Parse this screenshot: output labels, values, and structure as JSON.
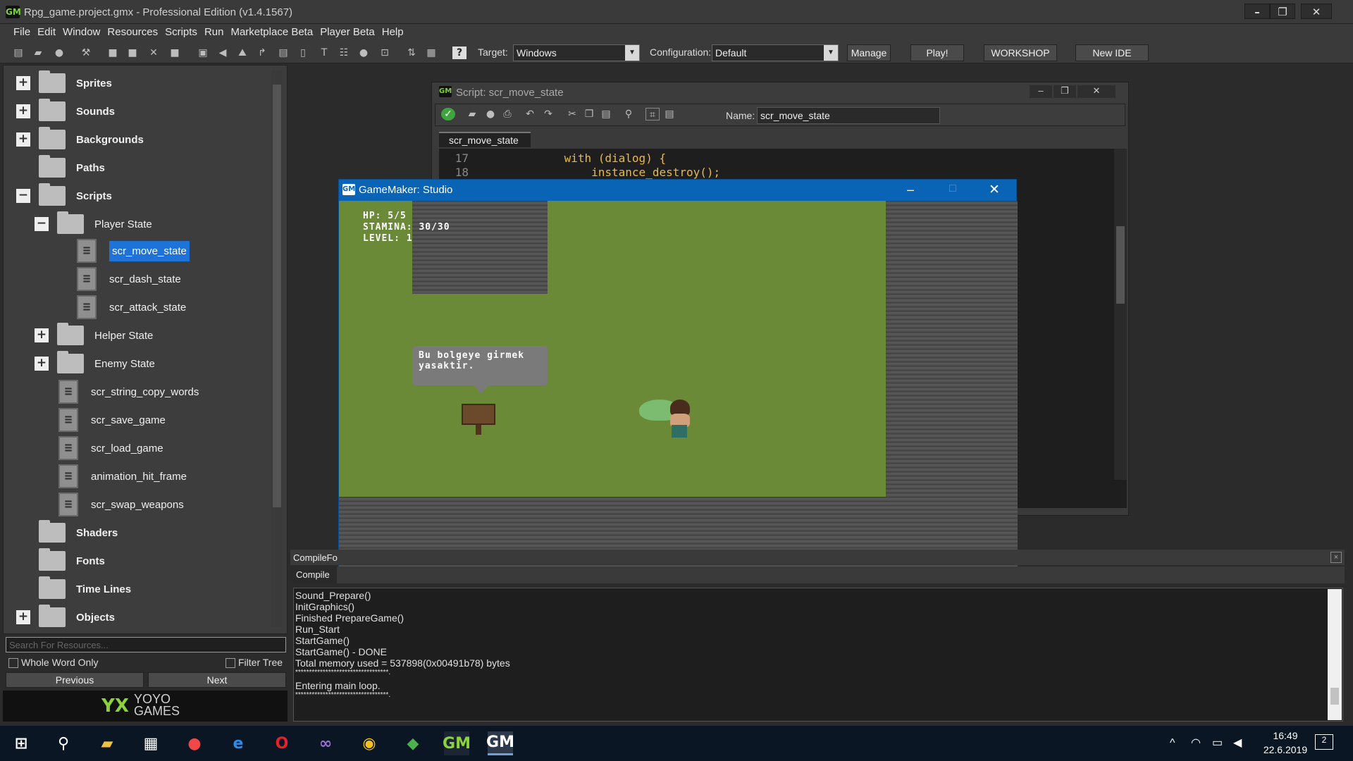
{
  "window": {
    "title": "Rpg_game.project.gmx  -  Professional Edition (v1.4.1567)",
    "controls": [
      "–",
      "❐",
      "✕"
    ]
  },
  "menu": [
    "File",
    "Edit",
    "Window",
    "Resources",
    "Scripts",
    "Run",
    "Marketplace Beta",
    "Player Beta",
    "Help"
  ],
  "toolbar": {
    "target_label": "Target:",
    "target_value": "Windows",
    "config_label": "Configuration:",
    "config_value": "Default",
    "manage": "Manage",
    "play": "Play!",
    "workshop": "WORKSHOP",
    "new_ide": "New IDE"
  },
  "tree": {
    "sprites": "Sprites",
    "sounds": "Sounds",
    "backgrounds": "Backgrounds",
    "paths": "Paths",
    "scripts": "Scripts",
    "player_state": "Player State",
    "scr_move_state": "scr_move_state",
    "scr_dash_state": "scr_dash_state",
    "scr_attack_state": "scr_attack_state",
    "helper_state": "Helper State",
    "enemy_state": "Enemy State",
    "scr_string_copy_words": "scr_string_copy_words",
    "scr_save_game": "scr_save_game",
    "scr_load_game": "scr_load_game",
    "animation_hit_frame": "animation_hit_frame",
    "scr_swap_weapons": "scr_swap_weapons",
    "shaders": "Shaders",
    "fonts": "Fonts",
    "time_lines": "Time Lines",
    "objects": "Objects"
  },
  "search": {
    "placeholder": "Search For Resources...",
    "whole_word": "Whole Word Only",
    "filter_tree": "Filter Tree",
    "previous": "Previous",
    "next": "Next"
  },
  "logo": {
    "line1": "YOYO",
    "line2": "GAMES"
  },
  "script_window": {
    "title": "Script: scr_move_state",
    "name_label": "Name:",
    "name_value": "scr_move_state",
    "tab": "scr_move_state",
    "lines": [
      {
        "num": "17",
        "code": "            with (dialog) {"
      },
      {
        "num": "18",
        "code": "                instance_destroy();"
      }
    ]
  },
  "game_window": {
    "title": "GameMaker: Studio",
    "hud": [
      "HP: 5/5",
      "STAMINA: 30/30",
      "LEVEL: 1"
    ],
    "dialog": "Bu bolgeye girmek yasaktir."
  },
  "output": {
    "tab_compile_form": "CompileFo",
    "tab_compile": "Compile",
    "lines": [
      "Sound_Prepare()",
      "InitGraphics()",
      "Finished PrepareGame()",
      "Run_Start",
      "StartGame()",
      "StartGame() - DONE",
      "Total memory used = 537898(0x00491b78) bytes",
      "**********************************.",
      "Entering main loop.",
      "**********************************."
    ]
  },
  "taskbar": {
    "time": "16:49",
    "date": "22.6.2019",
    "notifications": "2"
  }
}
